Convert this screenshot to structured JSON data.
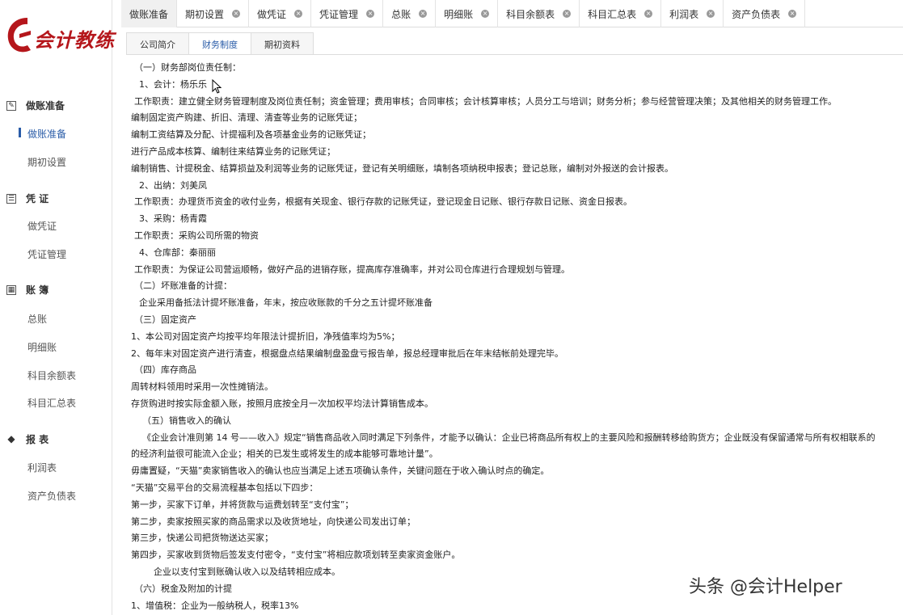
{
  "app": {
    "logo_text": "会计教练",
    "brand_color": "#b5161b",
    "accent_color": "#2a5ca8"
  },
  "sidebar": {
    "groups": [
      {
        "icon": "edit-icon",
        "label": "做账准备",
        "items": [
          {
            "label": "做账准备",
            "active": true
          },
          {
            "label": "期初设置",
            "active": false
          }
        ]
      },
      {
        "icon": "voucher-icon",
        "label": "凭 证",
        "items": [
          {
            "label": "做凭证"
          },
          {
            "label": "凭证管理"
          }
        ]
      },
      {
        "icon": "ledger-icon",
        "label": "账 簿",
        "items": [
          {
            "label": "总账"
          },
          {
            "label": "明细账"
          },
          {
            "label": "科目余额表"
          },
          {
            "label": "科目汇总表"
          }
        ]
      },
      {
        "icon": "layers-icon",
        "label": "报 表",
        "items": [
          {
            "label": "利润表"
          },
          {
            "label": "资产负债表"
          }
        ]
      }
    ]
  },
  "tabs": [
    {
      "label": "做账准备",
      "active": true,
      "closable": false
    },
    {
      "label": "期初设置",
      "closable": true
    },
    {
      "label": "做凭证",
      "closable": true
    },
    {
      "label": "凭证管理",
      "closable": true
    },
    {
      "label": "总账",
      "closable": true
    },
    {
      "label": "明细账",
      "closable": true
    },
    {
      "label": "科目余额表",
      "closable": true
    },
    {
      "label": "科目汇总表",
      "closable": true
    },
    {
      "label": "利润表",
      "closable": true
    },
    {
      "label": "资产负债表",
      "closable": true
    }
  ],
  "subtabs": [
    {
      "label": "公司简介"
    },
    {
      "label": "财务制度",
      "active": true
    },
    {
      "label": "期初资料"
    }
  ],
  "content": {
    "lines": [
      {
        "t": "（一）财务部岗位责任制：",
        "i": 1
      },
      {
        "t": "1、会计：杨乐乐",
        "i": 2
      },
      {
        "t": "工作职责：建立健全财务管理制度及岗位责任制；资金管理；费用审核；合同审核；会计核算审核；人员分工与培训；财务分析；参与经营管理决策；及其他相关的财务管理工作。",
        "i": 1
      },
      {
        "t": "编制固定资产购建、折旧、清理、清查等业务的记账凭证；",
        "i": 0
      },
      {
        "t": "编制工资结算及分配、计提福利及各项基金业务的记账凭证；",
        "i": 0
      },
      {
        "t": "进行产品成本核算、编制往来结算业务的记账凭证；",
        "i": 0
      },
      {
        "t": "编制销售、计提税金、结算损益及利润等业务的记账凭证，登记有关明细账，填制各项纳税申报表；登记总账，编制对外报送的会计报表。",
        "i": 0
      },
      {
        "t": "2、出纳：刘美凤",
        "i": 2
      },
      {
        "t": "工作职责：办理货币资金的收付业务，根据有关现金、银行存款的记账凭证，登记现金日记账、银行存款日记账、资金日报表。",
        "i": 1
      },
      {
        "t": "3、采购：杨青霞",
        "i": 2
      },
      {
        "t": "工作职责：采购公司所需的物资",
        "i": 1
      },
      {
        "t": "4、仓库部：秦丽丽",
        "i": 2
      },
      {
        "t": "工作职责：为保证公司营运顺畅，做好产品的进销存账，提高库存准确率，并对公司仓库进行合理规划与管理。",
        "i": 1
      },
      {
        "t": "（二）坏账准备的计提：",
        "i": 1
      },
      {
        "t": "企业采用备抵法计提坏账准备，年末，按应收账款的千分之五计提坏账准备",
        "i": 2
      },
      {
        "t": "（三）固定资产",
        "i": 1
      },
      {
        "t": "1、本公司对固定资产均按平均年限法计提折旧，净残值率均为5%；",
        "i": 0
      },
      {
        "t": "2、每年末对固定资产进行清查，根据盘点结果编制盘盈盘亏报告单，报总经理审批后在年末结帐前处理完毕。",
        "i": 0
      },
      {
        "t": "（四）库存商品",
        "i": 1
      },
      {
        "t": "周转材料领用时采用一次性摊销法。",
        "i": 0
      },
      {
        "t": "存货购进时按实际金额入账，按照月底按全月一次加权平均法计算销售成本。",
        "i": 0
      },
      {
        "t": "（五）销售收入的确认",
        "i": 3
      },
      {
        "t": "《企业会计准则第 14 号——收入》规定“销售商品收入同时满足下列条件，才能予以确认：企业已将商品所有权上的主要风险和报酬转移给购货方；企业既没有保留通常与所有权相联系的",
        "i": 3
      },
      {
        "t": "的经济利益很可能流入企业；相关的已发生或将发生的成本能够可靠地计量”。",
        "i": 0
      },
      {
        "t": "毋庸置疑，“天猫”卖家销售收入的确认也应当满足上述五项确认条件，关键问题在于收入确认时点的确定。",
        "i": 0
      },
      {
        "t": "“天猫”交易平台的交易流程基本包括以下四步：",
        "i": 0
      },
      {
        "t": "第一步，买家下订单，并将货款与运费划转至“支付宝”；",
        "i": 0
      },
      {
        "t": "第二步，卖家按照买家的商品需求以及收货地址，向快递公司发出订单；",
        "i": 0
      },
      {
        "t": "第三步，快递公司把货物送达买家；",
        "i": 0
      },
      {
        "t": "第四步，买家收到货物后签发支付密令，“支付宝”将相应款项划转至卖家资金账户。",
        "i": 0
      },
      {
        "t": "企业以支付宝到账确认收入以及结转相应成本。",
        "i": 4
      },
      {
        "t": "（六）税金及附加的计提",
        "i": 1
      },
      {
        "t": "1、增值税：企业为一般纳税人，税率13%",
        "i": 0
      }
    ]
  },
  "watermark": "头条 @会计Helper"
}
